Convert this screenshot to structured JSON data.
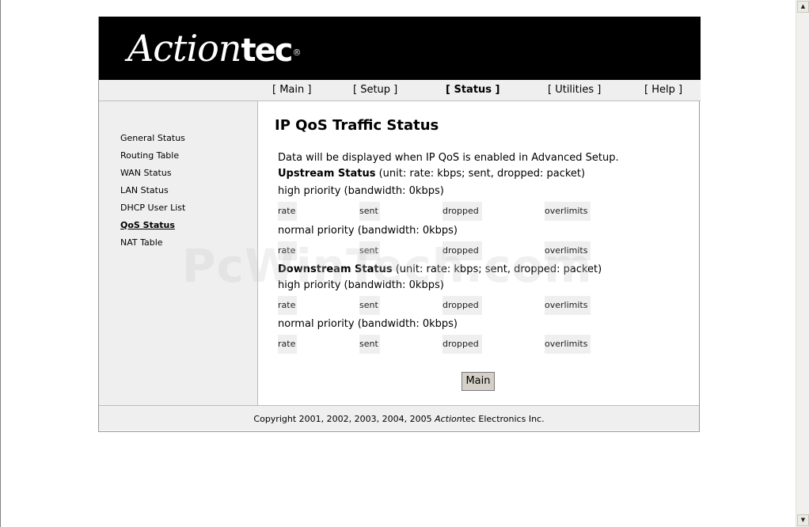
{
  "brand": {
    "logo_main": "Action",
    "logo_tec": "tec",
    "registered": "®"
  },
  "nav": [
    {
      "label": "[ Main ]"
    },
    {
      "label": "[ Setup ]"
    },
    {
      "label": "[ Status ]"
    },
    {
      "label": "[ Utilities ]"
    },
    {
      "label": "[ Help ]"
    }
  ],
  "sidebar": [
    {
      "label": "General Status"
    },
    {
      "label": "Routing Table"
    },
    {
      "label": "WAN Status"
    },
    {
      "label": "LAN Status"
    },
    {
      "label": "DHCP User List"
    },
    {
      "label": "QoS Status"
    },
    {
      "label": "NAT Table"
    }
  ],
  "page_title": "IP QoS Traffic Status",
  "info_text": "Data will be displayed when IP QoS is enabled in Advanced Setup.",
  "upstream": {
    "title": "Upstream Status",
    "units": "(unit: rate: kbps; sent, dropped: packet)"
  },
  "downstream": {
    "title": "Downstream Status",
    "units": "(unit: rate: kbps; sent, dropped: packet)"
  },
  "priorities": {
    "high": "high priority (bandwidth: 0kbps)",
    "normal": "normal priority (bandwidth: 0kbps)"
  },
  "columns": {
    "rate": "rate",
    "sent": "sent",
    "dropped": "dropped",
    "overlimits": "overlimits"
  },
  "main_button": "Main",
  "footer": {
    "prefix": "Copyright 2001, 2002, 2003, 2004, 2005 ",
    "brand_italic": "Action",
    "brand_rest": "tec Electronics Inc."
  },
  "watermark": "PcWinTech.com",
  "scrollbar": {
    "up": "▲",
    "down": "▼"
  }
}
